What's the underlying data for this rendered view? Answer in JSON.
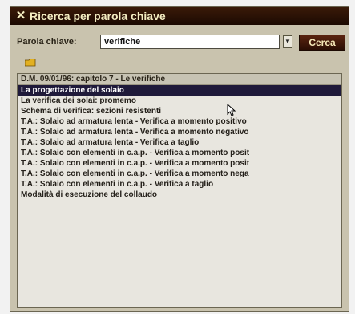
{
  "window": {
    "title": "Ricerca per parola chiave",
    "close_glyph": "✕"
  },
  "search": {
    "label": "Parola chiave:",
    "value": "verifiche",
    "dropdown_glyph": "▼",
    "button_label": "Cerca"
  },
  "results": {
    "header": "D.M. 09/01/96: capitolo 7 - Le verifiche",
    "selected_index": 0,
    "items": [
      "La progettazione del solaio",
      "La verifica dei solai: promemo",
      "Schema di verifica: sezioni resistenti",
      "T.A.: Solaio ad armatura lenta - Verifica a momento positivo",
      "T.A.: Solaio ad armatura lenta - Verifica a momento negativo",
      "T.A.: Solaio ad armatura lenta - Verifica a taglio",
      "T.A.: Solaio con elementi in c.a.p. - Verifica a momento posit",
      "T.A.: Solaio con elementi in c.a.p. - Verifica a momento posit",
      "T.A.: Solaio con elementi in c.a.p. - Verifica a momento nega",
      "T.A.: Solaio con elementi in c.a.p. - Verifica a taglio",
      "Modalità di esecuzione del collaudo"
    ]
  },
  "icons": {
    "folder": "folder-icon",
    "cursor": "mouse-cursor-icon"
  },
  "colors": {
    "titlebar": "#2b0e04",
    "selection": "#1f1a3a",
    "panel": "#c9c3ae"
  }
}
